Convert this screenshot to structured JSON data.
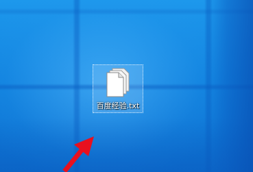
{
  "desktop": {
    "background_color": "#1284e0",
    "icons": [
      {
        "label": "百度经验.txt",
        "icon": "text-file-icon",
        "selected": true
      }
    ]
  },
  "annotation": {
    "icon": "red-arrow-icon",
    "color": "#e8101f"
  }
}
